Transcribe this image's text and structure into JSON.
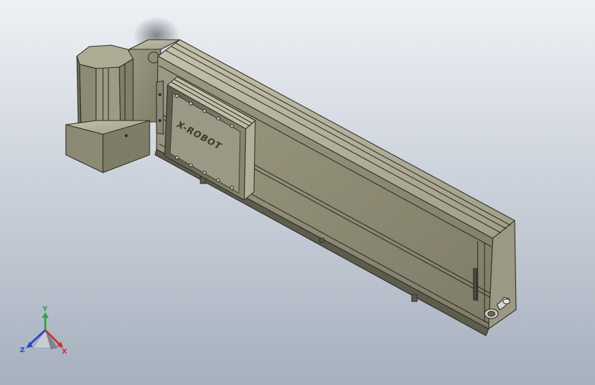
{
  "viewport": {
    "background_top": "#eef1f5",
    "background_bottom": "#a6b0be"
  },
  "model": {
    "carriage_logo": "X-ROBOT",
    "body_color": "#a7a48e",
    "edge_color": "#2c2c26"
  },
  "triad": {
    "x_label": "X",
    "y_label": "Y",
    "z_label": "Z",
    "x_color": "#d0302e",
    "y_color": "#2ea33a",
    "z_color": "#2a45c8"
  }
}
